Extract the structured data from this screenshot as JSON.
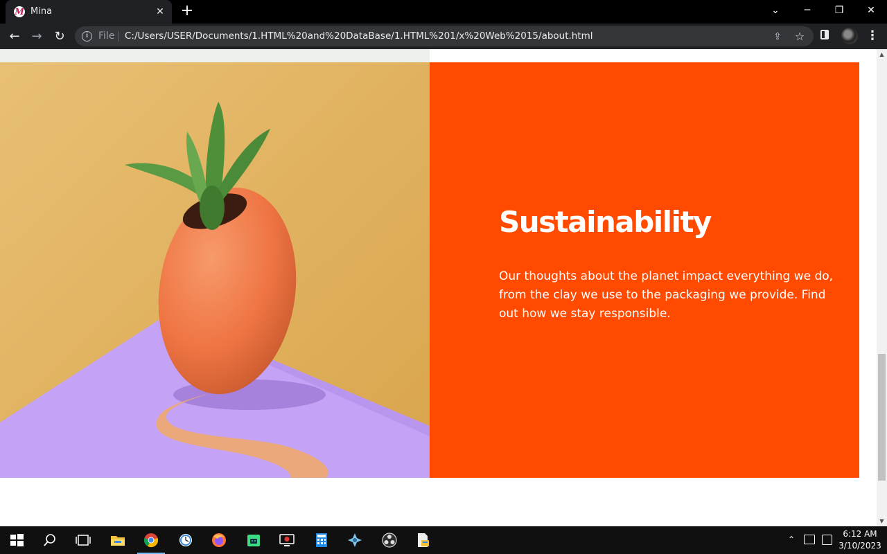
{
  "browser": {
    "tab": {
      "title": "Mina",
      "favicon_letter": "M",
      "close_glyph": "✕"
    },
    "new_tab_glyph": "+",
    "window": {
      "search_tabs_glyph": "⌄",
      "minimize_glyph": "─",
      "restore_glyph": "❐",
      "close_glyph": "✕"
    },
    "toolbar": {
      "back_glyph": "←",
      "forward_glyph": "→",
      "reload_glyph": "↻",
      "scheme_label": "File",
      "url": "C:/Users/USER/Documents/1.HTML%20and%20DataBase/1.HTML%201/x%20Web%2015/about.html",
      "share_glyph": "⇪",
      "star_glyph": "☆",
      "menu_glyph": "⋮"
    }
  },
  "page": {
    "sustainability": {
      "heading": "Sustainability",
      "body": "Our thoughts about the planet impact everything we do, from the clay we use to the packaging we provide. Find out how we stay responsible."
    },
    "colors": {
      "panel": "#ff4a00",
      "photo_wall": "#e8bf6c",
      "photo_floor": "#c4a3f7",
      "pot": "#f27a4c",
      "plant": "#4f8f3a"
    },
    "photo_subject": "terracotta egg-shaped planter with succulent on lilac surface"
  },
  "taskbar": {
    "apps": [
      "start-icon",
      "search-icon",
      "task-view-icon",
      "file-explorer-icon",
      "chrome-icon",
      "clock-app-icon",
      "firefox-icon",
      "android-studio-icon",
      "screen-recorder-icon",
      "calculator-icon",
      "game-icon",
      "obs-icon",
      "file-app-icon"
    ],
    "tray_up_glyph": "⌃",
    "time": "6:12 AM",
    "date": "3/10/2023"
  },
  "scrollbar": {
    "up_glyph": "▲",
    "down_glyph": "▼"
  }
}
